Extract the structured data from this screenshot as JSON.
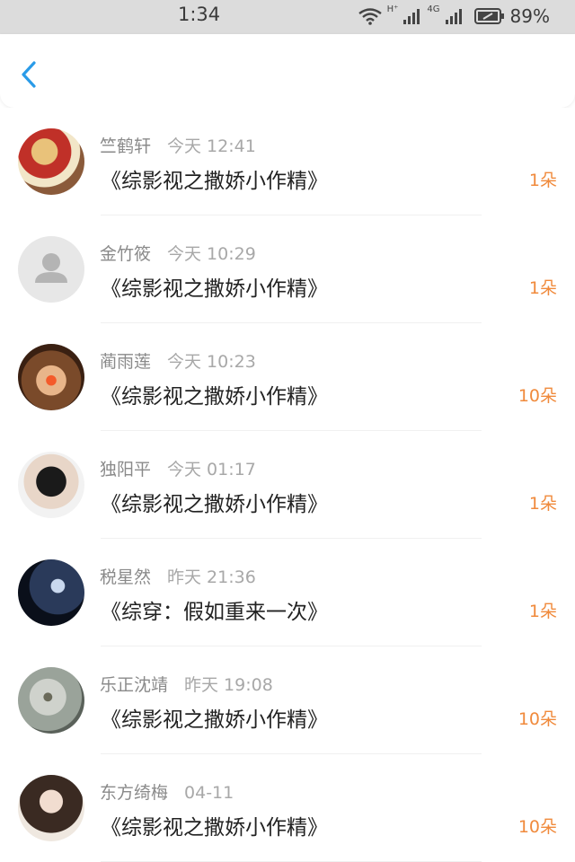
{
  "status_bar": {
    "time": "1:34",
    "network_label": "H⁺",
    "network_label_2": "4G",
    "battery": "89%"
  },
  "nav": {
    "back_icon": "chevron-left-icon"
  },
  "colors": {
    "accent_blue": "#2a9be8",
    "amount_orange": "#f08a3c"
  },
  "items": [
    {
      "name": "竺鹤轩",
      "time": "今天 12:41",
      "title": "《综影视之撒娇小作精》",
      "amount": "1朵",
      "avatar": "photo"
    },
    {
      "name": "金竹筱",
      "time": "今天 10:29",
      "title": "《综影视之撒娇小作精》",
      "amount": "1朵",
      "avatar": "default-user"
    },
    {
      "name": "蔺雨莲",
      "time": "今天 10:23",
      "title": "《综影视之撒娇小作精》",
      "amount": "10朵",
      "avatar": "photo"
    },
    {
      "name": "独阳平",
      "time": "今天 01:17",
      "title": "《综影视之撒娇小作精》",
      "amount": "1朵",
      "avatar": "photo"
    },
    {
      "name": "税星然",
      "time": "昨天 21:36",
      "title": "《综穿：假如重来一次》",
      "amount": "1朵",
      "avatar": "photo"
    },
    {
      "name": "乐正沈靖",
      "time": "昨天 19:08",
      "title": "《综影视之撒娇小作精》",
      "amount": "10朵",
      "avatar": "photo"
    },
    {
      "name": "东方绮梅",
      "time": "04-11",
      "title": "《综影视之撒娇小作精》",
      "amount": "10朵",
      "avatar": "photo"
    }
  ]
}
